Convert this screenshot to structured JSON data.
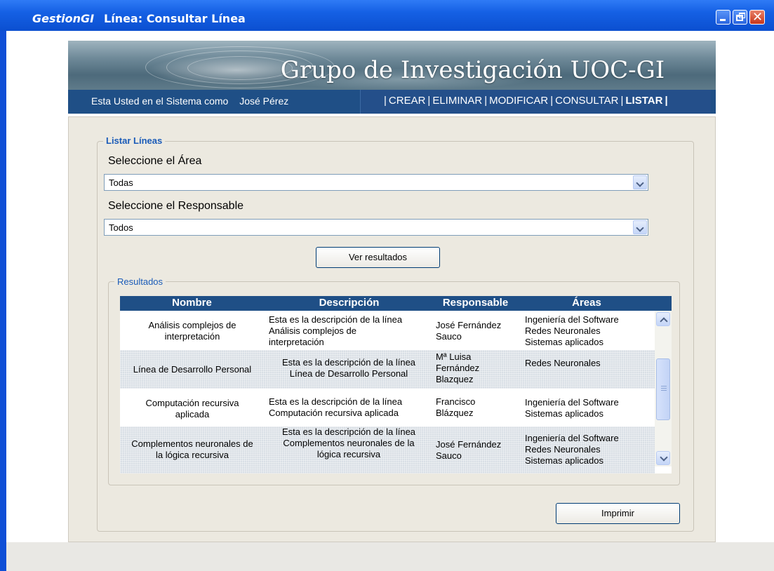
{
  "window": {
    "app_name": "GestionGI",
    "title": "Línea: Consultar Línea",
    "controls": {
      "minimize": "minimize-icon",
      "restore": "restore-icon",
      "close": "close-icon"
    }
  },
  "banner": {
    "title": "Grupo de Investigación UOC-GI"
  },
  "navbar": {
    "session_label": "Esta Usted en el Sistema como",
    "user_name": "José Pérez",
    "links": [
      {
        "label": "CREAR"
      },
      {
        "label": "ELIMINAR"
      },
      {
        "label": "MODIFICAR"
      },
      {
        "label": "CONSULTAR"
      },
      {
        "label": "LISTAR",
        "active": true
      }
    ],
    "separator": "|"
  },
  "form": {
    "legend": "Listar Líneas",
    "area_label": "Seleccione el Área",
    "area_value": "Todas",
    "responsable_label": "Seleccione el Responsable",
    "responsable_value": "Todos",
    "submit_label": "Ver resultados"
  },
  "results": {
    "legend": "Resultados",
    "columns": [
      "Nombre",
      "Descripción",
      "Responsable",
      "Áreas"
    ],
    "rows": [
      {
        "nombre": [
          "Análisis complejos de",
          "interpretación"
        ],
        "descripcion": [
          "Esta es la descripción de la línea",
          "Análisis complejos de",
          "interpretación"
        ],
        "responsable": [
          "José Fernández",
          "Sauco"
        ],
        "areas": [
          "Ingeniería del Software",
          "Redes Neuronales",
          "Sistemas aplicados"
        ]
      },
      {
        "nombre": [
          "Línea de Desarrollo Personal"
        ],
        "descripcion": [
          "Esta es la descripción de la línea",
          "Línea de Desarrollo Personal"
        ],
        "responsable": [
          "Mª Luisa",
          "Fernández",
          "Blazquez"
        ],
        "areas": [
          "Redes Neuronales"
        ]
      },
      {
        "nombre": [
          "Computación recursiva",
          "aplicada"
        ],
        "descripcion": [
          "Esta es la descripción de la línea",
          "Computación recursiva aplicada"
        ],
        "responsable": [
          "Francisco",
          "Blázquez"
        ],
        "areas": [
          "Ingeniería del Software",
          "Sistemas aplicados"
        ]
      },
      {
        "nombre": [
          "Complementos neuronales de",
          "la lógica recursiva"
        ],
        "descripcion": [
          "Esta es la descripción de la línea",
          "Complementos neuronales de la",
          "lógica recursiva"
        ],
        "responsable": [
          "José Fernández",
          "Sauco"
        ],
        "areas": [
          "Ingeniería del Software",
          "Redes Neuronales",
          "Sistemas aplicados"
        ]
      }
    ]
  },
  "print_label": "Imprimir",
  "colors": {
    "title_bar": "#0b4fd0",
    "nav_bar": "#1f4f86",
    "legend_text": "#1a5bb8",
    "panel": "#ece9e0"
  }
}
